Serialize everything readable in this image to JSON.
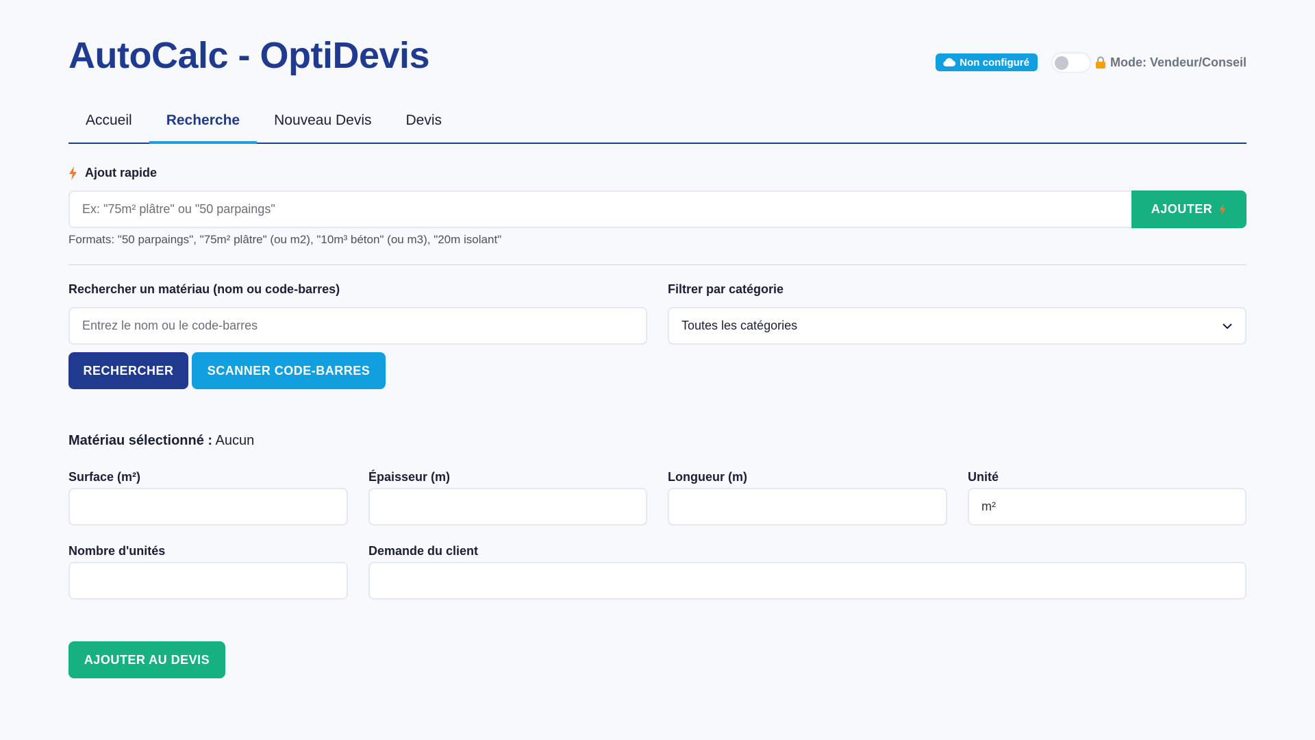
{
  "header": {
    "title": "AutoCalc - OptiDevis",
    "cloud_badge": "Non configuré",
    "mode_label": "Mode: Vendeur/Conseil"
  },
  "tabs": [
    {
      "label": "Accueil",
      "active": false
    },
    {
      "label": "Recherche",
      "active": true
    },
    {
      "label": "Nouveau Devis",
      "active": false
    },
    {
      "label": "Devis",
      "active": false
    }
  ],
  "quick_add": {
    "label": "Ajout rapide",
    "placeholder": "Ex: \"75m² plâtre\" ou \"50 parpaings\"",
    "button_label": "AJOUTER",
    "formats_hint": "Formats: \"50 parpaings\", \"75m² plâtre\" (ou m2), \"10m³ béton\" (ou m3), \"20m isolant\""
  },
  "search": {
    "label": "Rechercher un matériau (nom ou code-barres)",
    "placeholder": "Entrez le nom ou le code-barres",
    "search_button": "RECHERCHER",
    "scan_button": "SCANNER CODE-BARRES"
  },
  "filter": {
    "label": "Filtrer par catégorie",
    "selected": "Toutes les catégories"
  },
  "selection": {
    "label": "Matériau sélectionné :",
    "value": "Aucun"
  },
  "form": {
    "surface_label": "Surface (m²)",
    "epaisseur_label": "Épaisseur (m)",
    "longueur_label": "Longueur (m)",
    "unite_label": "Unité",
    "unite_value": "m²",
    "nombre_label": "Nombre d'unités",
    "demande_label": "Demande du client",
    "submit_label": "AJOUTER AU DEVIS"
  },
  "colors": {
    "primary": "#1f3a8f",
    "accent": "#129fe0",
    "success": "#16b17e",
    "background": "#f7f9fc"
  }
}
